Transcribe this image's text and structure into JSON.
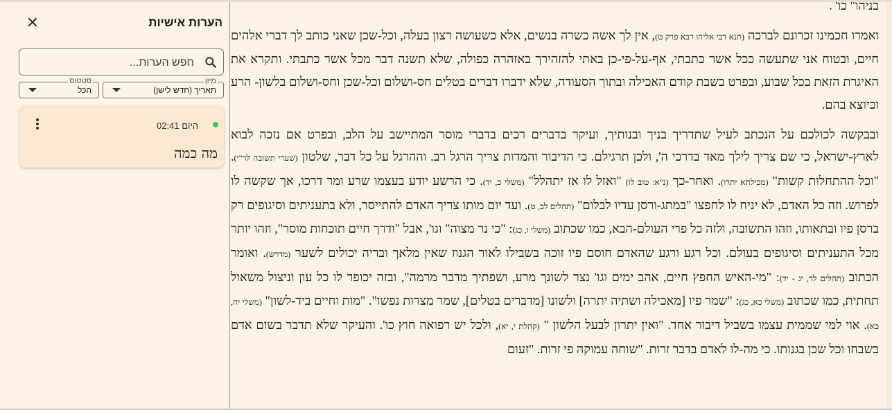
{
  "panel": {
    "title": "הערות אישיות",
    "close_label": "✕",
    "search_placeholder": "חפש הערות...",
    "sort": {
      "label": "מיון",
      "value": "תאריך (חדש לישן)"
    },
    "status": {
      "label": "סטטוס",
      "value": "הכל"
    },
    "notes": [
      {
        "time": "היום 02:41",
        "text": "מה כמה",
        "status_color": "#34c759"
      }
    ]
  },
  "reader": {
    "p0": "בניהו\" כו' .",
    "p1_a": "ואמרו חכמינו זכרונם לברכה ",
    "p1_s1": "(תנא דבי אליהו רבא פרק ט)",
    "p1_b": ", אין לך אשה כשרה בנשים, אלא כשעושה רצון בעלה, וכל-שכן שאני כותב לך דברי אלהים חיים, ובטוח אני שתעשה ככל אשר כתבתי, אף-על-פי-כן באתי להזהירך באזהרה כפולה, שלא תשנה דבר מכל אשר כתבתי. ותקרא את האיגרת הזאת בכל שבוע, ובפרט בשבת קודם האכילה ובתוך הסעודה, שלא ידברו דברים בטלים חס-ושלום וכל-שכן וחס-ושלום בלשון- הרע וכיוצא בהם.",
    "p2_a": "ובבקשה לכולכם על הנכתב לעיל שתדריך בניך ובנותיך, ועיקר בדברים רכים בדברי מוסר המתיישב על הלב, ובפרט אם נזכה לבוא לארץ-ישראל, כי שם צריך לילך מאד בדרכי ה', ולכן תרגילם. כי הדיבור והמדות צריך הרגל רב. וההרגל על כל דבר, שלטון ",
    "p2_s1": "(שערי תשובה לר\"י)",
    "p2_b": ". \"וכל ההתחלות קשות\" ",
    "p2_s2": "(מכילתא יתרו)",
    "p2_c": ". ואחר-כך ",
    "p2_s3": "(נ\"א: טוב לו)",
    "p2_d": " \"ואזל לו אז יתהלל\" ",
    "p2_s4": "(משלי כ, יד)",
    "p2_e": ". כי הרשע יודע בעצמו שרע ומר דרכו, אך שקשה לו לפרוש. וזה כל האדם, לא יניח לו לחפצו \"במתג-ורסן עדיו לבלום\" ",
    "p2_s5": "(תהלים לב, ט)",
    "p2_f": ". ועד יום מותו צריך האדם להתייסר, ולא בתעניתים וסיגופים רק ברסן פיו ובתאותו, וזהו התשובה, ולזה כל פרי העולם-הבא, כמו שכתוב ",
    "p2_s6": "(משלי ו, כג)",
    "p2_g": ": \"כי נר מצוה\" וגו', אבל \"ודרך חיים תוכחות מוסר\", וזהו יותר מכל התעניתים וסיגופים בעולם. וכל רגע ורגע שהאדם חוסם פיו זוכה בשבילו לאור הגנוז שאין מלאך ובריה יכולים לשער ",
    "p2_s7": "(מדרש)",
    "p2_h": ". ואומר הכתוב ",
    "p2_s8": "(תהלים לד, יג - יד)",
    "p2_i": ": \"מי-האיש החפץ חיים, אהב ימים וגו' נצר לשונך מרע, ושפתיך מדבר מרמה\", ובזה יכופר לו כל עון וניצול משאול תחתית, כמו שכתוב ",
    "p2_s9": "(משלי כא, כג)",
    "p2_j": ": \"שמר פיו [מאכילה ושתיה יתרה] ולשונו [מדברים בטלים], שמר מצרות נפשו\". \"מות וחיים ביד-לשון\" ",
    "p2_s10": "(משלי יח, כא)",
    "p2_k": ". אוי למי שממית עצמו בשביל דיבור אחד. \"ואין יתרון לבעל הלשון \" ",
    "p2_s11": "(קהלת י, יא)",
    "p2_l": ", ולכל יש רפואה חוץ כו'. והעיקר שלא תדבר בשום אדם בשבחו וכל שכן בגנותו. כי מה-לו לאדם בדבר זרות. \"שוחה עמוקה פי זרות. \"זעום"
  }
}
